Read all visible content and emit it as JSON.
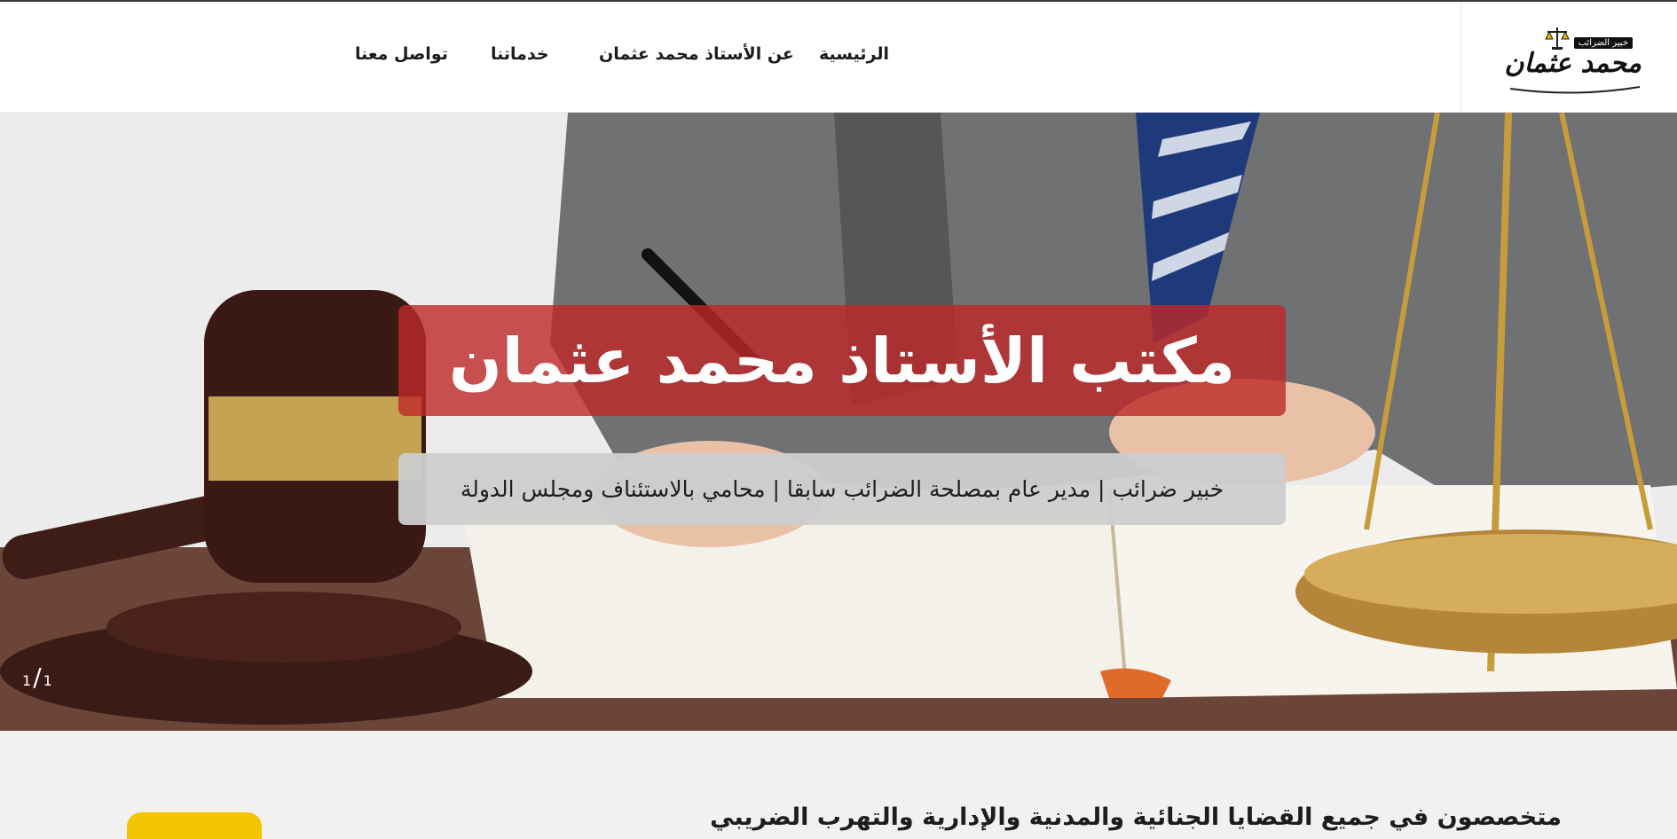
{
  "header": {
    "logo": {
      "badge": "خبير الضرائب",
      "name": "محمد عثمان",
      "icon": "scales-of-justice-icon"
    },
    "nav": [
      {
        "label": "الرئيسية"
      },
      {
        "label": "عن الأستاذ محمد عثمان"
      },
      {
        "label": "خدماتنا"
      },
      {
        "label": "تواصل معنا"
      }
    ]
  },
  "hero": {
    "title": "مكتب الأستاذ محمد عثمان",
    "subtitle": "خبير ضرائب | مدير عام بمصلحة الضرائب سابقا | محامي بالاستئناف ومجلس الدولة",
    "slide_current": "1",
    "slide_total": "1",
    "colors": {
      "title_bar": "#be2828",
      "subtitle_bar": "#cdcdcd"
    }
  },
  "section": {
    "title": "متخصصون في جميع القضايا الجنائية والمدنية والإدارية والتهرب الضريبي"
  },
  "colors": {
    "accent_yellow": "#f5c400",
    "text_dark": "#1b1b1b"
  }
}
